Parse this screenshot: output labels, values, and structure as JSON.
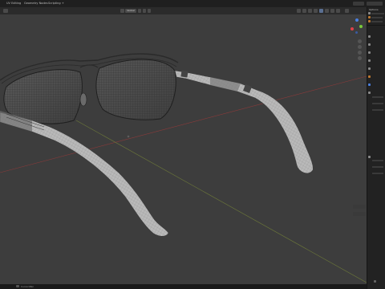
{
  "topbar": {
    "tabs": [
      {
        "label": "UV Editing",
        "active": false
      },
      {
        "label": "Geometry Nodes",
        "active": false
      },
      {
        "label": "Scripting",
        "active": false
      }
    ],
    "add_tab": "+"
  },
  "header": {
    "view_mode": "Global",
    "overlay_label": "",
    "shading_label": ""
  },
  "outliner": {
    "header": "Options",
    "items": [
      "",
      "",
      "",
      "",
      "",
      ""
    ]
  },
  "status": {
    "left_text": "Cursor/Pan"
  },
  "gizmo": {
    "x_color": "#e0404a",
    "y_color": "#7ac93a",
    "z_color": "#4a7fe0"
  },
  "colors": {
    "viewport_bg": "#3d3d3d",
    "x_axis_line": "#8a3a3a",
    "y_axis_line": "#6e7a3a",
    "mesh": "#bdbdbd",
    "wire": "#2a2a2a"
  }
}
